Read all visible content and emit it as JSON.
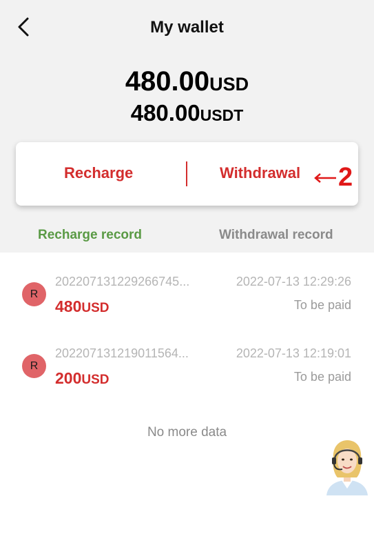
{
  "header": {
    "title": "My wallet",
    "back_icon": "chevron-left-icon"
  },
  "balance": {
    "primary_amount": "480.00",
    "primary_currency": "USD",
    "secondary_amount": "480.00",
    "secondary_currency": "USDT"
  },
  "actions": {
    "recharge_label": "Recharge",
    "withdrawal_label": "Withdrawal",
    "annotation": "2"
  },
  "tabs": {
    "recharge_record": "Recharge record",
    "withdrawal_record": "Withdrawal record",
    "active": "recharge_record"
  },
  "records": [
    {
      "badge": "R",
      "id": "202207131229266745...",
      "amount": "480",
      "currency": "USD",
      "time": "2022-07-13 12:29:26",
      "status": "To be paid"
    },
    {
      "badge": "R",
      "id": "202207131219011564...",
      "amount": "200",
      "currency": "USD",
      "time": "2022-07-13 12:19:01",
      "status": "To be paid"
    }
  ],
  "list_footer": "No more data",
  "support_icon": "customer-service-agent-icon",
  "colors": {
    "accent_red": "#d32d2d",
    "active_tab_green": "#5a9a45",
    "inactive_tab_gray": "#8a8a8a",
    "badge_red": "#e06468",
    "header_bg": "#f2f2f2"
  }
}
